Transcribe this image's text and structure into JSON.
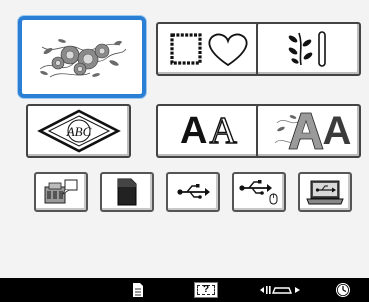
{
  "categories": [
    {
      "name": "embroidery-patterns",
      "icon": "floral-pattern-icon",
      "selected": true
    },
    {
      "name": "frame-patterns",
      "icon": "square-heart-frame-icon",
      "selected": false
    },
    {
      "name": "border-patterns",
      "icon": "vine-bar-icon",
      "selected": false
    },
    {
      "name": "monogram-patterns",
      "icon": "abc-monogram-icon",
      "label": "ABC",
      "selected": false
    },
    {
      "name": "character-patterns",
      "icon": "letter-aa-icon",
      "letters": [
        "A",
        "A"
      ],
      "selected": false
    },
    {
      "name": "decorative-alphabet",
      "icon": "decorative-letter-a-icon",
      "letters": [
        "A",
        "A"
      ],
      "selected": false
    }
  ],
  "sources": [
    {
      "name": "embroidery-card",
      "icon": "machine-card-icon"
    },
    {
      "name": "memory-card",
      "icon": "sd-card-icon"
    },
    {
      "name": "usb-port",
      "icon": "usb-icon"
    },
    {
      "name": "usb-mouse-port",
      "icon": "usb-mouse-icon"
    },
    {
      "name": "computer-connection",
      "icon": "laptop-usb-icon"
    }
  ],
  "bottom_bar": {
    "icons": [
      "document-icon",
      "frame-display-icon",
      "presser-foot-icon",
      "clock-icon"
    ],
    "frame_glyph": "?"
  },
  "colors": {
    "selected_border": "#2a7fd4",
    "button_border": "#444444",
    "bar_background": "#000000"
  }
}
